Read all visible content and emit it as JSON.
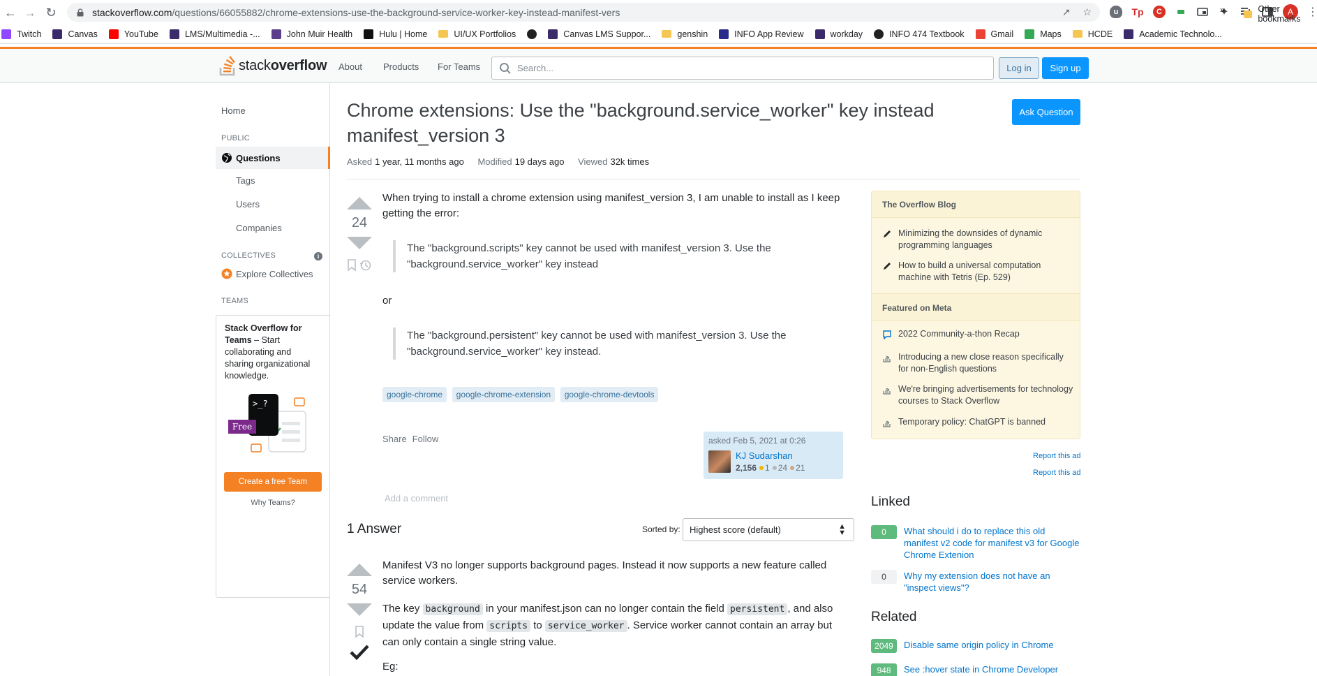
{
  "browser": {
    "url_host": "stackoverflow.com",
    "url_path": "/questions/66055882/chrome-extensions-use-the-background-service-worker-key-instead-manifest-vers",
    "bookmarks": [
      {
        "label": "Twitch",
        "icon": "twitch-icon",
        "color": "#9146ff"
      },
      {
        "label": "Canvas",
        "icon": "w-icon",
        "color": "#3b2b6b"
      },
      {
        "label": "YouTube",
        "icon": "youtube-icon",
        "color": "#ff0000"
      },
      {
        "label": "LMS/Multimedia -...",
        "icon": "w-icon",
        "color": "#3b2b6b"
      },
      {
        "label": "John Muir Health",
        "icon": "jmh-icon",
        "color": "#5b3f8c"
      },
      {
        "label": "Hulu | Home",
        "icon": "hulu-icon",
        "color": "#111111"
      },
      {
        "label": "UI/UX Portfolios",
        "icon": "folder-icon",
        "color": "#f5c652"
      },
      {
        "label": "",
        "icon": "globe-icon",
        "color": "#222222"
      },
      {
        "label": "Canvas LMS Suppor...",
        "icon": "w-icon",
        "color": "#3b2b6b"
      },
      {
        "label": "genshin",
        "icon": "folder-icon",
        "color": "#f5c652"
      },
      {
        "label": "INFO App Review",
        "icon": "info-icon",
        "color": "#2a2a8a"
      },
      {
        "label": "workday",
        "icon": "w-icon",
        "color": "#3b2b6b"
      },
      {
        "label": "INFO 474 Textbook",
        "icon": "globe-icon",
        "color": "#222222"
      },
      {
        "label": "Gmail",
        "icon": "gmail-icon",
        "color": "#ea4335"
      },
      {
        "label": "Maps",
        "icon": "maps-icon",
        "color": "#34a853"
      },
      {
        "label": "HCDE",
        "icon": "folder-icon",
        "color": "#f5c652"
      },
      {
        "label": "Academic Technolo...",
        "icon": "w-icon",
        "color": "#3b2b6b"
      }
    ],
    "more_label": "»",
    "other_bookmarks": "Other bookmarks",
    "profile_initial": "A"
  },
  "topbar": {
    "logo_light": "stack",
    "logo_bold": "overflow",
    "nav": [
      "About",
      "Products",
      "For Teams"
    ],
    "search_placeholder": "Search...",
    "login": "Log in",
    "signup": "Sign up"
  },
  "leftnav": {
    "home": "Home",
    "public_head": "PUBLIC",
    "questions": "Questions",
    "tags": "Tags",
    "users": "Users",
    "companies": "Companies",
    "collectives_head": "COLLECTIVES",
    "explore_collectives": "Explore Collectives",
    "teams_head": "TEAMS",
    "teams_title_bold": "Stack Overflow for Teams",
    "teams_title_rest": " – Start collaborating and sharing organizational knowledge.",
    "free_badge": "Free",
    "create_team": "Create a free Team",
    "why_teams": "Why Teams?"
  },
  "question": {
    "title": "Chrome extensions: Use the \"background.service_worker\" key instead manifest_version 3",
    "ask_button": "Ask Question",
    "asked_label": "Asked",
    "asked_value": "1 year, 11 months ago",
    "modified_label": "Modified",
    "modified_value": "19 days ago",
    "viewed_label": "Viewed",
    "viewed_value": "32k times",
    "score": "24",
    "body_intro": "When trying to install a chrome extension using manifest_version 3, I am unable to install as I keep getting the error:",
    "quote1": "The \"background.scripts\" key cannot be used with manifest_version 3. Use the \"background.service_worker\" key instead",
    "or_text": "or",
    "quote2": "The \"background.persistent\" key cannot be used with manifest_version 3. Use the \"background.service_worker\" key instead.",
    "tags": [
      "google-chrome",
      "google-chrome-extension",
      "google-chrome-devtools"
    ],
    "share": "Share",
    "follow": "Follow",
    "asked_card": "asked Feb 5, 2021 at 0:26",
    "user_name": "KJ Sudarshan",
    "user_rep": "2,156",
    "badges_gold": "1",
    "badges_silver": "24",
    "badges_bronze": "21",
    "add_comment": "Add a comment"
  },
  "answers": {
    "count_label": "1 Answer",
    "sorted_by": "Sorted by:",
    "sort_value": "Highest score (default)",
    "score": "54",
    "p1": "Manifest V3 no longer supports background pages. Instead it now supports a new feature called service workers.",
    "p2_a": "The key ",
    "p2_code1": "background",
    "p2_b": " in your manifest.json can no longer contain the field ",
    "p2_code2": "persistent",
    "p2_c": ", and also update the value from ",
    "p2_code3": "scripts",
    "p2_d": " to ",
    "p2_code4": "service_worker",
    "p2_e": ". Service worker cannot contain an array but can only contain a single string value.",
    "p3": "Eg:"
  },
  "sidebar": {
    "blog_head": "The Overflow Blog",
    "blog_items": [
      "Minimizing the downsides of dynamic programming languages",
      "How to build a universal computation machine with Tetris (Ep. 529)"
    ],
    "meta_head": "Featured on Meta",
    "meta_items": [
      "2022 Community-a-thon Recap",
      "Introducing a new close reason specifically for non-English questions",
      "We're bringing advertisements for technology courses to Stack Overflow",
      "Temporary policy: ChatGPT is banned"
    ],
    "report_ad_1": "Report this ad",
    "report_ad_2": "Report this ad",
    "linked_head": "Linked",
    "linked": [
      {
        "score": "0",
        "text": "What should i do to replace this old manifest v2 code for manifest v3 for Google Chrome Extenion"
      },
      {
        "score": "0",
        "text": "Why my extension does not have an \"inspect views\"?"
      }
    ],
    "related_head": "Related",
    "related": [
      {
        "score": "2049",
        "text": "Disable same origin policy in Chrome"
      },
      {
        "score": "948",
        "text": "See :hover state in Chrome Developer Tools"
      }
    ]
  },
  "colors": {
    "accent_orange": "#f48225",
    "link_blue": "#0074cc",
    "primary_button": "#0a95ff"
  }
}
